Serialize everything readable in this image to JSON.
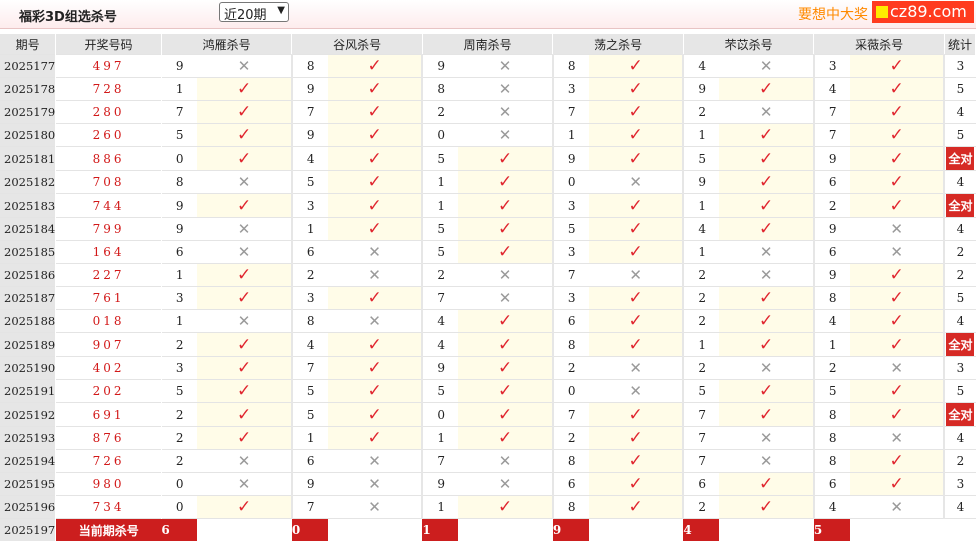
{
  "header": {
    "title": "福彩3D组选杀号",
    "period_select": "近20期",
    "promo": "要想中大奖",
    "brand": "cz89.com"
  },
  "columns": [
    "期号",
    "开奖号码",
    "鸿雁杀号",
    "谷风杀号",
    "周南杀号",
    "荡之杀号",
    "芣苡杀号",
    "采薇杀号",
    "统计"
  ],
  "rows": [
    {
      "issue": "2025177",
      "nums": "497",
      "k": [
        {
          "n": "9",
          "h": false
        },
        {
          "n": "8",
          "h": true
        },
        {
          "n": "9",
          "h": false
        },
        {
          "n": "8",
          "h": true
        },
        {
          "n": "4",
          "h": false
        },
        {
          "n": "3",
          "h": true
        }
      ],
      "count": "3"
    },
    {
      "issue": "2025178",
      "nums": "728",
      "k": [
        {
          "n": "1",
          "h": true
        },
        {
          "n": "9",
          "h": true
        },
        {
          "n": "8",
          "h": false
        },
        {
          "n": "3",
          "h": true
        },
        {
          "n": "9",
          "h": true
        },
        {
          "n": "4",
          "h": true
        }
      ],
      "count": "5"
    },
    {
      "issue": "2025179",
      "nums": "280",
      "k": [
        {
          "n": "7",
          "h": true
        },
        {
          "n": "7",
          "h": true
        },
        {
          "n": "2",
          "h": false
        },
        {
          "n": "7",
          "h": true
        },
        {
          "n": "2",
          "h": false
        },
        {
          "n": "7",
          "h": true
        }
      ],
      "count": "4"
    },
    {
      "issue": "2025180",
      "nums": "260",
      "k": [
        {
          "n": "5",
          "h": true
        },
        {
          "n": "9",
          "h": true
        },
        {
          "n": "0",
          "h": false
        },
        {
          "n": "1",
          "h": true
        },
        {
          "n": "1",
          "h": true
        },
        {
          "n": "7",
          "h": true
        }
      ],
      "count": "5"
    },
    {
      "issue": "2025181",
      "nums": "886",
      "k": [
        {
          "n": "0",
          "h": true
        },
        {
          "n": "4",
          "h": true
        },
        {
          "n": "5",
          "h": true
        },
        {
          "n": "9",
          "h": true
        },
        {
          "n": "5",
          "h": true
        },
        {
          "n": "9",
          "h": true
        }
      ],
      "count": "全对"
    },
    {
      "issue": "2025182",
      "nums": "708",
      "k": [
        {
          "n": "8",
          "h": false
        },
        {
          "n": "5",
          "h": true
        },
        {
          "n": "1",
          "h": true
        },
        {
          "n": "0",
          "h": false
        },
        {
          "n": "9",
          "h": true
        },
        {
          "n": "6",
          "h": true
        }
      ],
      "count": "4"
    },
    {
      "issue": "2025183",
      "nums": "744",
      "k": [
        {
          "n": "9",
          "h": true
        },
        {
          "n": "3",
          "h": true
        },
        {
          "n": "1",
          "h": true
        },
        {
          "n": "3",
          "h": true
        },
        {
          "n": "1",
          "h": true
        },
        {
          "n": "2",
          "h": true
        }
      ],
      "count": "全对"
    },
    {
      "issue": "2025184",
      "nums": "799",
      "k": [
        {
          "n": "9",
          "h": false
        },
        {
          "n": "1",
          "h": true
        },
        {
          "n": "5",
          "h": true
        },
        {
          "n": "5",
          "h": true
        },
        {
          "n": "4",
          "h": true
        },
        {
          "n": "9",
          "h": false
        }
      ],
      "count": "4"
    },
    {
      "issue": "2025185",
      "nums": "164",
      "k": [
        {
          "n": "6",
          "h": false
        },
        {
          "n": "6",
          "h": false
        },
        {
          "n": "5",
          "h": true
        },
        {
          "n": "3",
          "h": true
        },
        {
          "n": "1",
          "h": false
        },
        {
          "n": "6",
          "h": false
        }
      ],
      "count": "2"
    },
    {
      "issue": "2025186",
      "nums": "227",
      "k": [
        {
          "n": "1",
          "h": true
        },
        {
          "n": "2",
          "h": false
        },
        {
          "n": "2",
          "h": false
        },
        {
          "n": "7",
          "h": false
        },
        {
          "n": "2",
          "h": false
        },
        {
          "n": "9",
          "h": true
        }
      ],
      "count": "2"
    },
    {
      "issue": "2025187",
      "nums": "761",
      "k": [
        {
          "n": "3",
          "h": true
        },
        {
          "n": "3",
          "h": true
        },
        {
          "n": "7",
          "h": false
        },
        {
          "n": "3",
          "h": true
        },
        {
          "n": "2",
          "h": true
        },
        {
          "n": "8",
          "h": true
        }
      ],
      "count": "5"
    },
    {
      "issue": "2025188",
      "nums": "018",
      "k": [
        {
          "n": "1",
          "h": false
        },
        {
          "n": "8",
          "h": false
        },
        {
          "n": "4",
          "h": true
        },
        {
          "n": "6",
          "h": true
        },
        {
          "n": "2",
          "h": true
        },
        {
          "n": "4",
          "h": true
        }
      ],
      "count": "4"
    },
    {
      "issue": "2025189",
      "nums": "907",
      "k": [
        {
          "n": "2",
          "h": true
        },
        {
          "n": "4",
          "h": true
        },
        {
          "n": "4",
          "h": true
        },
        {
          "n": "8",
          "h": true
        },
        {
          "n": "1",
          "h": true
        },
        {
          "n": "1",
          "h": true
        }
      ],
      "count": "全对"
    },
    {
      "issue": "2025190",
      "nums": "402",
      "k": [
        {
          "n": "3",
          "h": true
        },
        {
          "n": "7",
          "h": true
        },
        {
          "n": "9",
          "h": true
        },
        {
          "n": "2",
          "h": false
        },
        {
          "n": "2",
          "h": false
        },
        {
          "n": "2",
          "h": false
        }
      ],
      "count": "3"
    },
    {
      "issue": "2025191",
      "nums": "202",
      "k": [
        {
          "n": "5",
          "h": true
        },
        {
          "n": "5",
          "h": true
        },
        {
          "n": "5",
          "h": true
        },
        {
          "n": "0",
          "h": false
        },
        {
          "n": "5",
          "h": true
        },
        {
          "n": "5",
          "h": true
        }
      ],
      "count": "5"
    },
    {
      "issue": "2025192",
      "nums": "691",
      "k": [
        {
          "n": "2",
          "h": true
        },
        {
          "n": "5",
          "h": true
        },
        {
          "n": "0",
          "h": true
        },
        {
          "n": "7",
          "h": true
        },
        {
          "n": "7",
          "h": true
        },
        {
          "n": "8",
          "h": true
        }
      ],
      "count": "全对"
    },
    {
      "issue": "2025193",
      "nums": "876",
      "k": [
        {
          "n": "2",
          "h": true
        },
        {
          "n": "1",
          "h": true
        },
        {
          "n": "1",
          "h": true
        },
        {
          "n": "2",
          "h": true
        },
        {
          "n": "7",
          "h": false
        },
        {
          "n": "8",
          "h": false
        }
      ],
      "count": "4"
    },
    {
      "issue": "2025194",
      "nums": "726",
      "k": [
        {
          "n": "2",
          "h": false
        },
        {
          "n": "6",
          "h": false
        },
        {
          "n": "7",
          "h": false
        },
        {
          "n": "8",
          "h": true
        },
        {
          "n": "7",
          "h": false
        },
        {
          "n": "8",
          "h": true
        }
      ],
      "count": "2"
    },
    {
      "issue": "2025195",
      "nums": "980",
      "k": [
        {
          "n": "0",
          "h": false
        },
        {
          "n": "9",
          "h": false
        },
        {
          "n": "9",
          "h": false
        },
        {
          "n": "6",
          "h": true
        },
        {
          "n": "6",
          "h": true
        },
        {
          "n": "6",
          "h": true
        }
      ],
      "count": "3"
    },
    {
      "issue": "2025196",
      "nums": "734",
      "k": [
        {
          "n": "0",
          "h": true
        },
        {
          "n": "7",
          "h": false
        },
        {
          "n": "1",
          "h": true
        },
        {
          "n": "8",
          "h": true
        },
        {
          "n": "2",
          "h": true
        },
        {
          "n": "4",
          "h": false
        }
      ],
      "count": "4"
    }
  ],
  "current": {
    "issue": "2025197",
    "label": "当前期杀号",
    "kills": [
      "6",
      "0",
      "1",
      "9",
      "4",
      "5"
    ]
  },
  "colors": {
    "hit": "#e0262f",
    "miss": "#9a9a9a",
    "badge": "#d62a25",
    "header_bg": "#e6e6e6"
  },
  "icons": {
    "hit": "check-icon",
    "miss": "cross-icon"
  }
}
